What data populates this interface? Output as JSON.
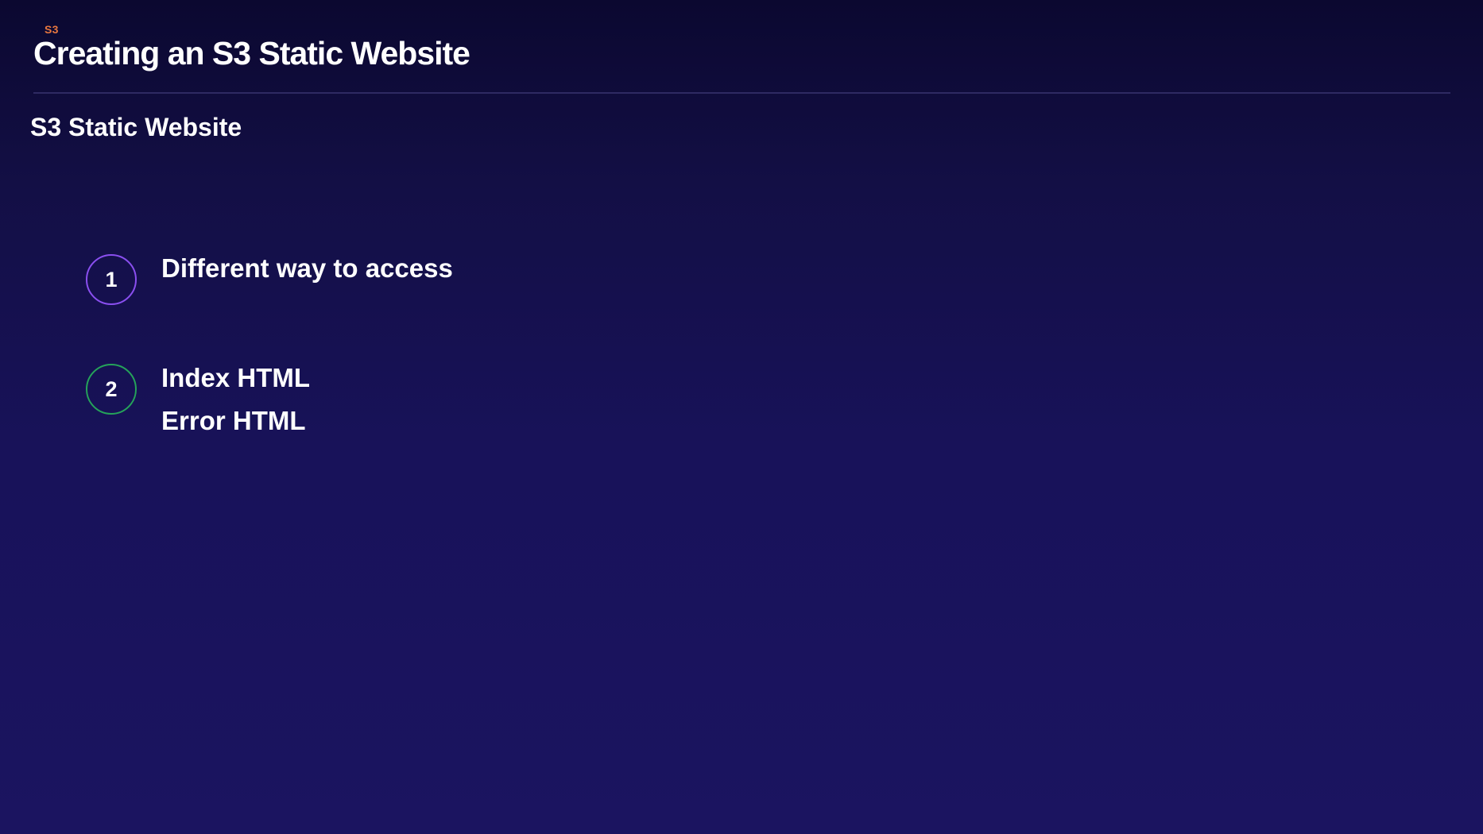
{
  "slide": {
    "section_tag": "S3",
    "title": "Creating an S3 Static Website",
    "subtitle": "S3 Static Website",
    "points": [
      {
        "number": "1",
        "lines": [
          "Different way to access"
        ],
        "accent_color": "#8a4ff0"
      },
      {
        "number": "2",
        "lines": [
          "Index HTML",
          "Error HTML"
        ],
        "accent_color": "#25a35a"
      }
    ]
  },
  "colors": {
    "background_top": "#0b0830",
    "background_bottom": "#1b1460",
    "section_tag": "#e8773f",
    "text": "#ffffff"
  }
}
